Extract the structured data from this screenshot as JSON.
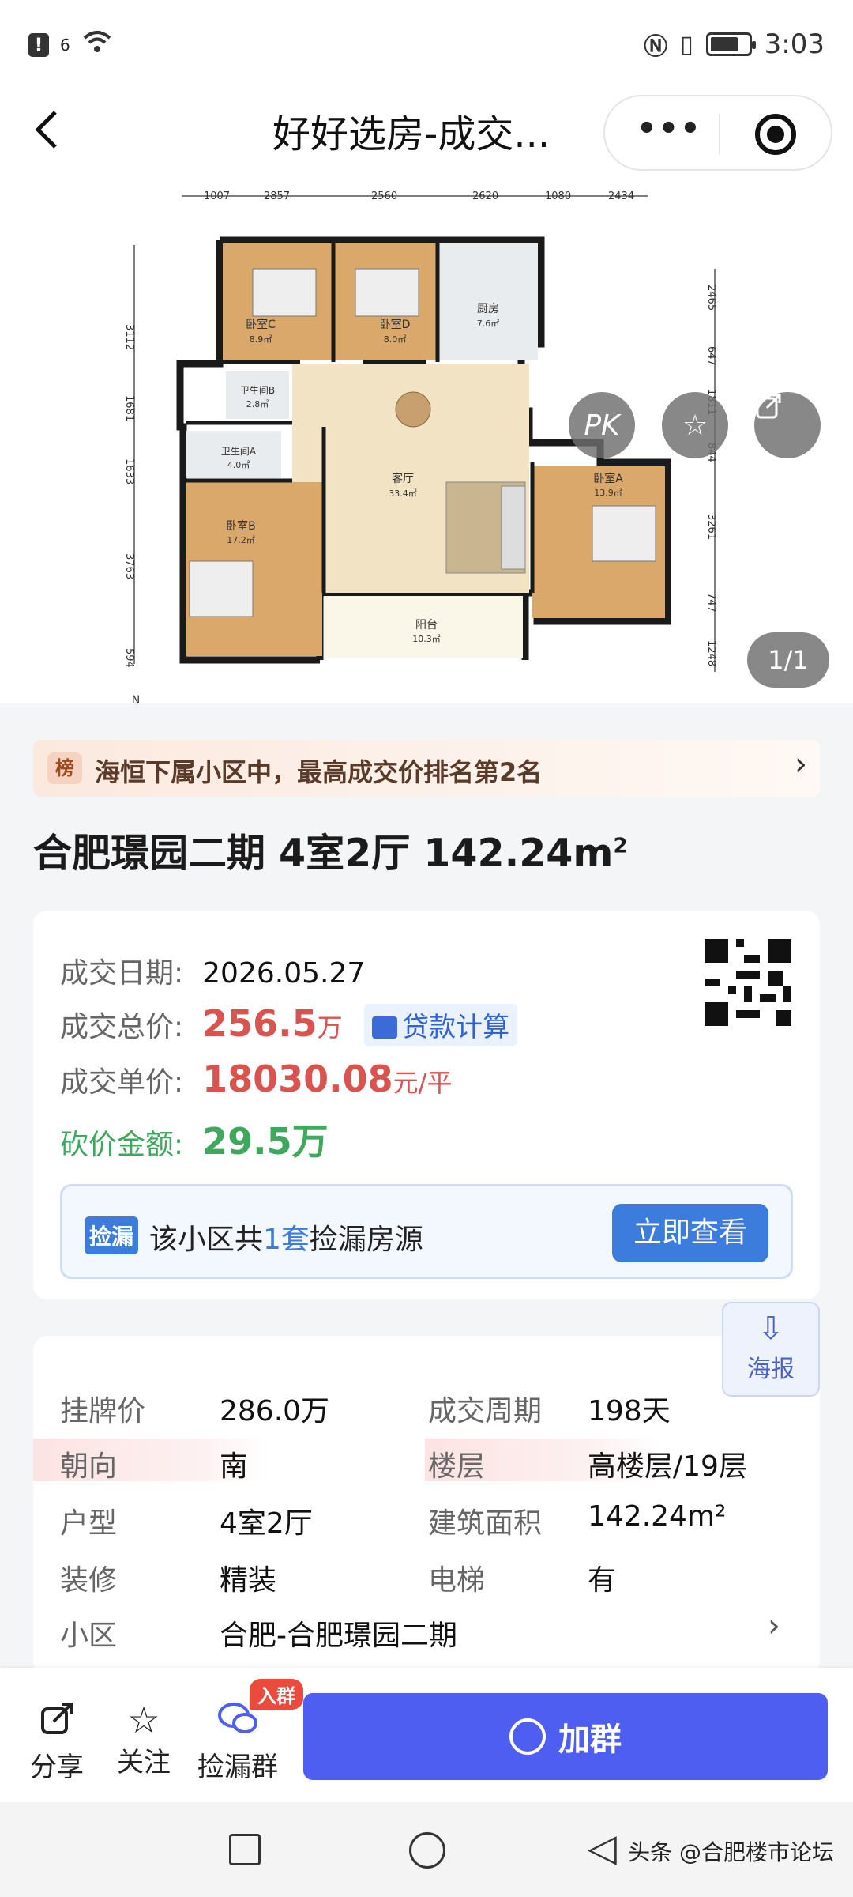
{
  "status": {
    "signal_label": "6",
    "time": "3:03",
    "battery_level": 0.75
  },
  "nav": {
    "back_icon": "arrow-left-icon",
    "title": "好好选房-成交...",
    "more_icon": "more-dots-icon",
    "close_icon": "target-icon"
  },
  "plan": {
    "top_dims": [
      "1007",
      "2857",
      "2560",
      "2620",
      "1080",
      "2434"
    ],
    "left_dims": [
      "3112",
      "1681",
      "1633",
      "3763",
      "594"
    ],
    "right_dims": [
      "2465",
      "647",
      "1811",
      "844",
      "3261",
      "747",
      "1248"
    ],
    "rooms": {
      "bedC": "卧室C",
      "bedC_area": "8.9㎡",
      "bedD": "卧室D",
      "bedD_area": "8.0㎡",
      "kitchen": "厨房",
      "kitchen_area": "7.6㎡",
      "bathB": "卫生间B",
      "bathB_area": "2.8㎡",
      "bathA": "卫生间A",
      "bathA_area": "4.0㎡",
      "living": "客厅",
      "living_area": "33.4㎡",
      "bedA": "卧室A",
      "bedA_area": "13.9㎡",
      "bedB": "卧室B",
      "bedB_area": "17.2㎡",
      "balcony": "阳台",
      "balcony_area": "10.3㎡"
    },
    "compass": "N",
    "pk_label": "PK",
    "favorite_icon": "star-icon",
    "share_icon": "share-icon",
    "counter": "1/1"
  },
  "rank": {
    "badge": "榜",
    "text": "海恒下属小区中，最高成交价排名第2名"
  },
  "listing": {
    "title": "合肥璟园二期 4室2厅 142.24m",
    "title_sup": "2"
  },
  "deal": {
    "date_label": "成交日期:",
    "date_value": "2026.05.27",
    "total_label": "成交总价:",
    "total_value": "256.5",
    "total_unit": "万",
    "loan_label": "贷款计算",
    "unit_label": "成交单价:",
    "unit_value": "18030.08",
    "unit_unit": "元/平",
    "discount_label": "砍价金额:",
    "discount_value": "29.5万"
  },
  "pick": {
    "tag": "捡漏",
    "text_prefix": "该小区共",
    "count": "1套",
    "text_suffix": "捡漏房源",
    "button": "立即查看"
  },
  "poster": {
    "icon": "download-icon",
    "label": "海报"
  },
  "details": [
    {
      "label": "挂牌价",
      "value": "286.0万",
      "label2": "成交周期",
      "value2": "198天"
    },
    {
      "label": "朝向",
      "value": "南",
      "label2": "楼层",
      "value2": "高楼层/19层"
    },
    {
      "label": "户型",
      "value": "4室2厅",
      "label2": "建筑面积",
      "value2": "142.24m²"
    },
    {
      "label": "装修",
      "value": "精装",
      "label2": "电梯",
      "value2": "有"
    },
    {
      "label": "小区",
      "value": "合肥-合肥璟园二期"
    }
  ],
  "bottom": {
    "share": "分享",
    "follow": "关注",
    "group": "捡漏群",
    "group_badge": "入群",
    "join": "加群"
  },
  "sysnav": {
    "watermark": "头条 @合肥楼市论坛"
  },
  "colors": {
    "accent_blue": "#3b7cdc",
    "join_button": "#4e5ef0",
    "price_red": "#d9534f",
    "discount_green": "#3ea85c",
    "floor_wood": "#d9a86a"
  }
}
